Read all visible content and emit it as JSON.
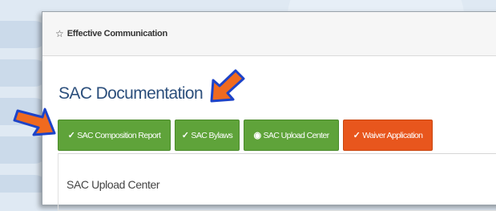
{
  "panel": {
    "star_icon": "☆",
    "header_title": "Effective Communication",
    "section_title": "SAC Documentation"
  },
  "buttons": [
    {
      "label": "SAC Composition Report",
      "icon": "edit-icon",
      "color": "#5fa33a"
    },
    {
      "label": "SAC Bylaws",
      "icon": "edit-icon",
      "color": "#5fa33a"
    },
    {
      "label": "SAC Upload Center",
      "icon": "upload-icon",
      "color": "#5fa33a"
    },
    {
      "label": "Waiver Application",
      "icon": "edit-icon",
      "color": "#e8561d"
    }
  ],
  "content": {
    "active_tab_label": "SAC Upload Center"
  },
  "annotations": {
    "arrow_color": "#f06a1f",
    "arrow_outline": "#1d43c8"
  }
}
